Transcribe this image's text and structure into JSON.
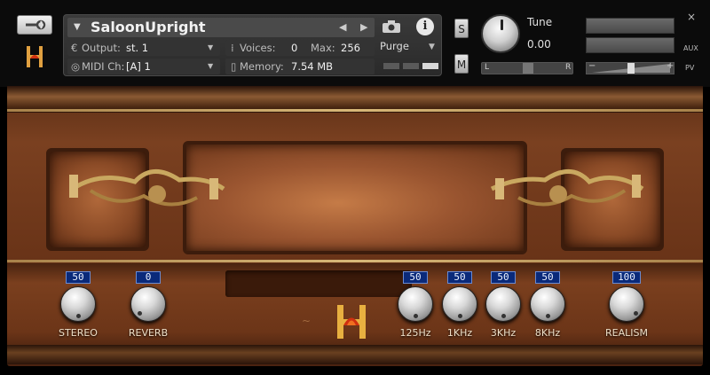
{
  "header": {
    "instrument_name": "SaloonUpright",
    "output_label": "Output:",
    "output_value": "st. 1",
    "voices_label": "Voices:",
    "voices_value": "0",
    "max_label": "Max:",
    "max_value": "256",
    "purge_label": "Purge",
    "midi_label": "MIDI Ch:",
    "midi_value": "[A]  1",
    "memory_label": "Memory:",
    "memory_value": "7.54 MB",
    "solo_label": "S",
    "mute_label": "M",
    "tune_label": "Tune",
    "tune_value": "0.00",
    "pan_left": "L",
    "pan_right": "R",
    "close_label": "×",
    "aux_label": "AUX",
    "pv_label": "PV",
    "minus_label": "−",
    "plus_label": "+"
  },
  "controls": [
    {
      "label": "STEREO",
      "value": "50"
    },
    {
      "label": "REVERB",
      "value": "0"
    },
    {
      "label": "125Hz",
      "value": "50"
    },
    {
      "label": "1KHz",
      "value": "50"
    },
    {
      "label": "3KHz",
      "value": "50"
    },
    {
      "label": "8KHz",
      "value": "50"
    },
    {
      "label": "REALISM",
      "value": "100"
    }
  ],
  "colors": {
    "value_box_bg": "#0a2a7a",
    "wood": "#7a4020",
    "gold": "#d8b878"
  },
  "icons": [
    "wrench-icon",
    "camera-icon",
    "info-icon",
    "logo-h-icon"
  ]
}
